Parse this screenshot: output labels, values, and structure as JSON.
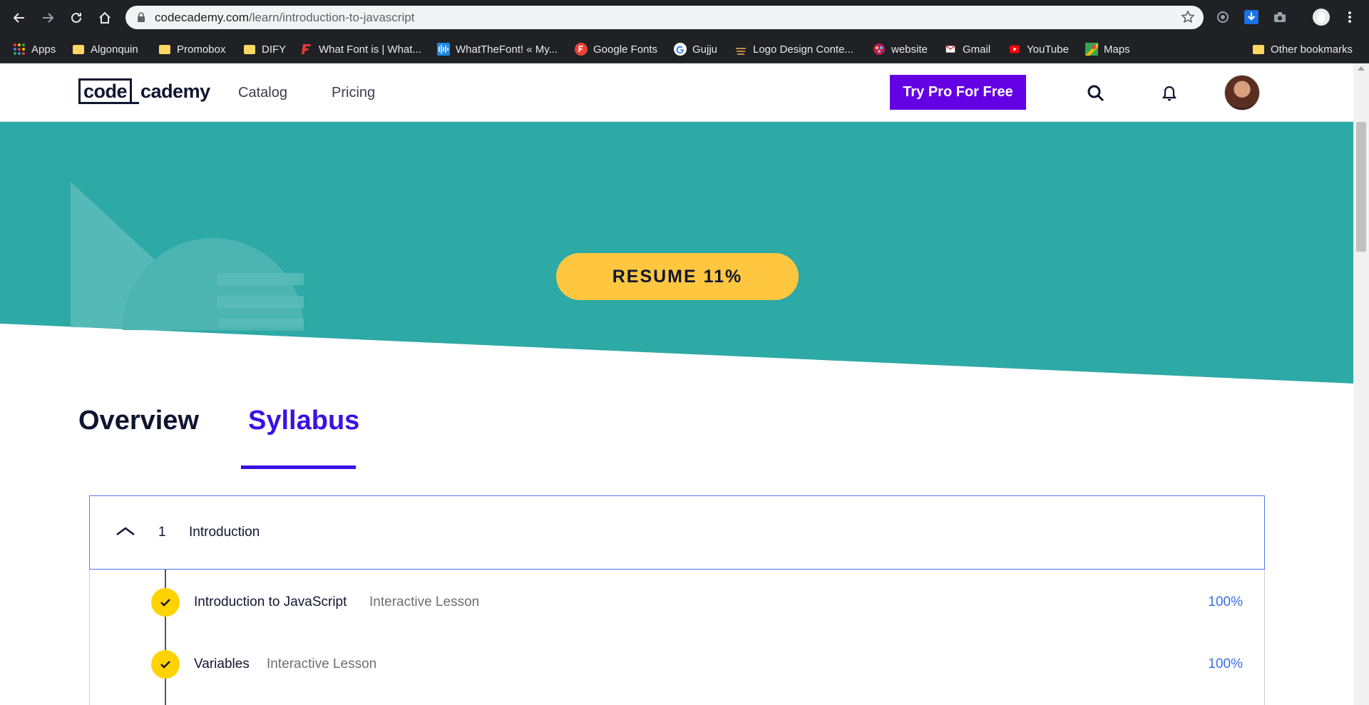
{
  "browser": {
    "url_host": "codecademy.com",
    "url_path": "/learn/introduction-to-javascript",
    "bookmarks": [
      {
        "label": "Apps",
        "icon": "apps-grid-icon"
      },
      {
        "label": "Algonquin",
        "icon": "folder-icon"
      },
      {
        "label": "Promobox",
        "icon": "folder-icon"
      },
      {
        "label": "DIFY",
        "icon": "folder-icon"
      },
      {
        "label": "What Font is | What...",
        "icon": "whatfontis-icon"
      },
      {
        "label": "WhatTheFont! « My...",
        "icon": "whatthefont-icon"
      },
      {
        "label": "Google Fonts",
        "icon": "google-fonts-icon"
      },
      {
        "label": "Gujju",
        "icon": "google-icon"
      },
      {
        "label": "Logo Design Conte...",
        "icon": "logo-design-icon"
      },
      {
        "label": "website",
        "icon": "website-icon"
      },
      {
        "label": "Gmail",
        "icon": "gmail-icon"
      },
      {
        "label": "YouTube",
        "icon": "youtube-icon"
      },
      {
        "label": "Maps",
        "icon": "maps-icon"
      }
    ],
    "other_bookmarks": "Other bookmarks"
  },
  "header": {
    "logo_code": "code",
    "logo_rest": "cademy",
    "nav": [
      "Catalog",
      "Pricing"
    ],
    "cta": "Try Pro For Free"
  },
  "hero": {
    "resume_label": "RESUME 11%",
    "progress_percent": 11
  },
  "tabs": {
    "overview": "Overview",
    "syllabus": "Syllabus",
    "active": "Syllabus"
  },
  "module": {
    "number": "1",
    "title": "Introduction",
    "expanded": true
  },
  "lessons": [
    {
      "name": "Introduction to JavaScript",
      "kind": "Interactive Lesson",
      "percent": "100%",
      "completed": true
    },
    {
      "name": "Variables",
      "kind": "Interactive Lesson",
      "percent": "100%",
      "completed": true
    }
  ],
  "colors": {
    "brand_purple": "#6400e4",
    "hero_teal": "#2da9a6",
    "resume_yellow": "#ffc740",
    "syllabus_accent": "#3a10e5",
    "check_yellow": "#ffd300",
    "percent_blue": "#3a6fe0"
  }
}
